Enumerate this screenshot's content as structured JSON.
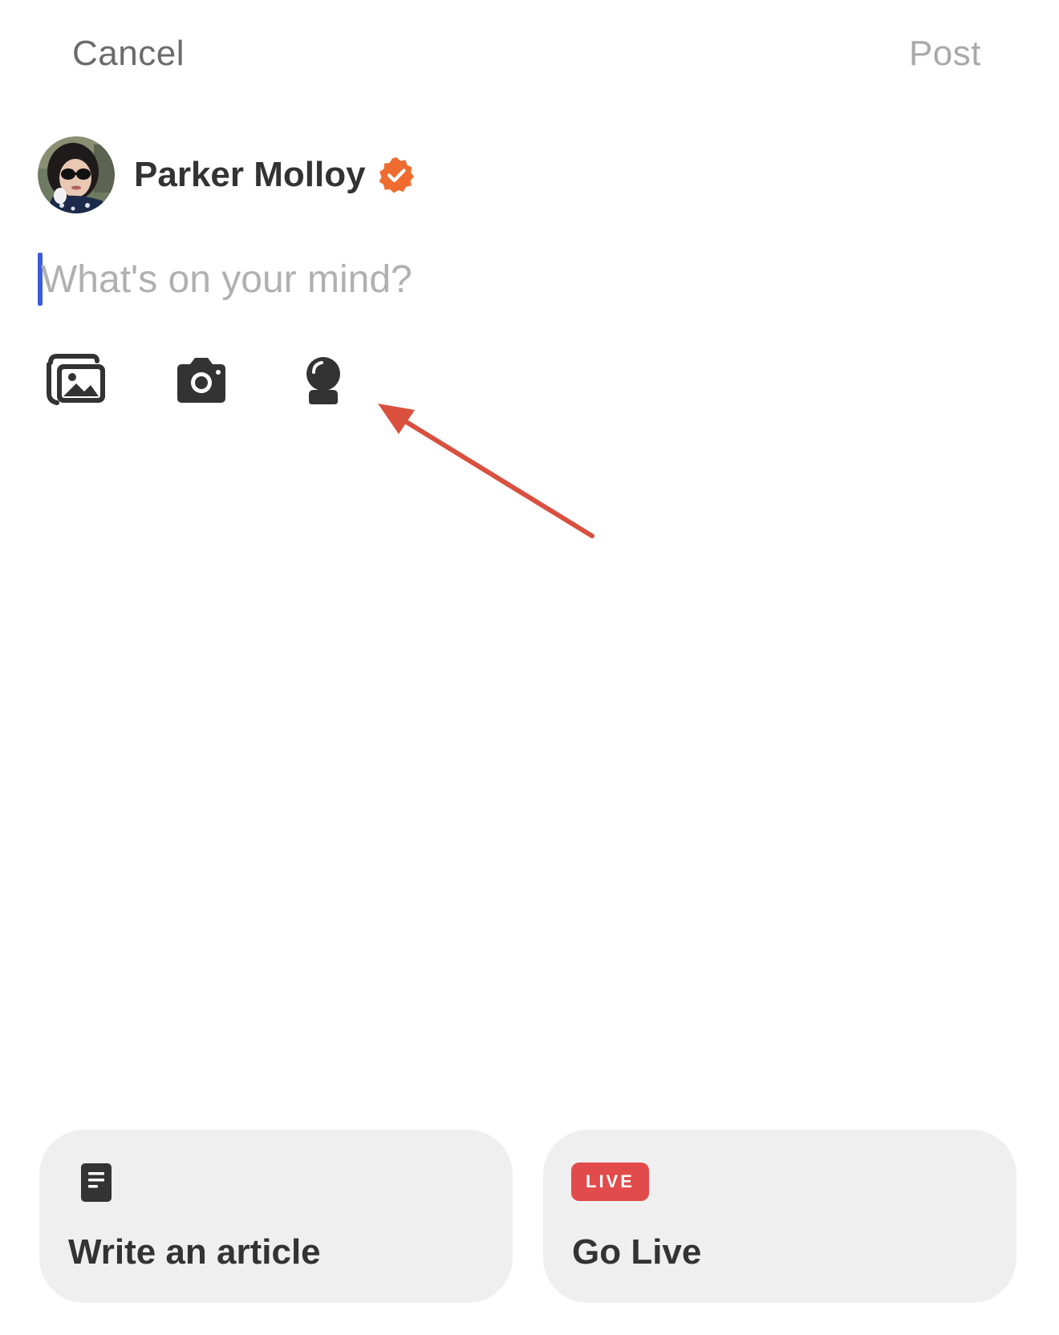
{
  "header": {
    "cancel_label": "Cancel",
    "post_label": "Post"
  },
  "author": {
    "name": "Parker Molloy",
    "verified": true,
    "verified_color": "#ef6b2f"
  },
  "composer": {
    "placeholder": "What's on your mind?",
    "value": ""
  },
  "tools": [
    {
      "icon": "photo-gallery-icon"
    },
    {
      "icon": "camera-icon"
    },
    {
      "icon": "crystal-ball-icon"
    }
  ],
  "annotation": {
    "arrow_color": "#d9503f"
  },
  "cards": {
    "article": {
      "label": "Write an article",
      "icon": "document-icon"
    },
    "live": {
      "label": "Go Live",
      "badge": "LIVE",
      "badge_color": "#e24b4b"
    }
  },
  "colors": {
    "caret": "#3b5bdb",
    "card_bg": "#efefef",
    "icon": "#333333"
  }
}
